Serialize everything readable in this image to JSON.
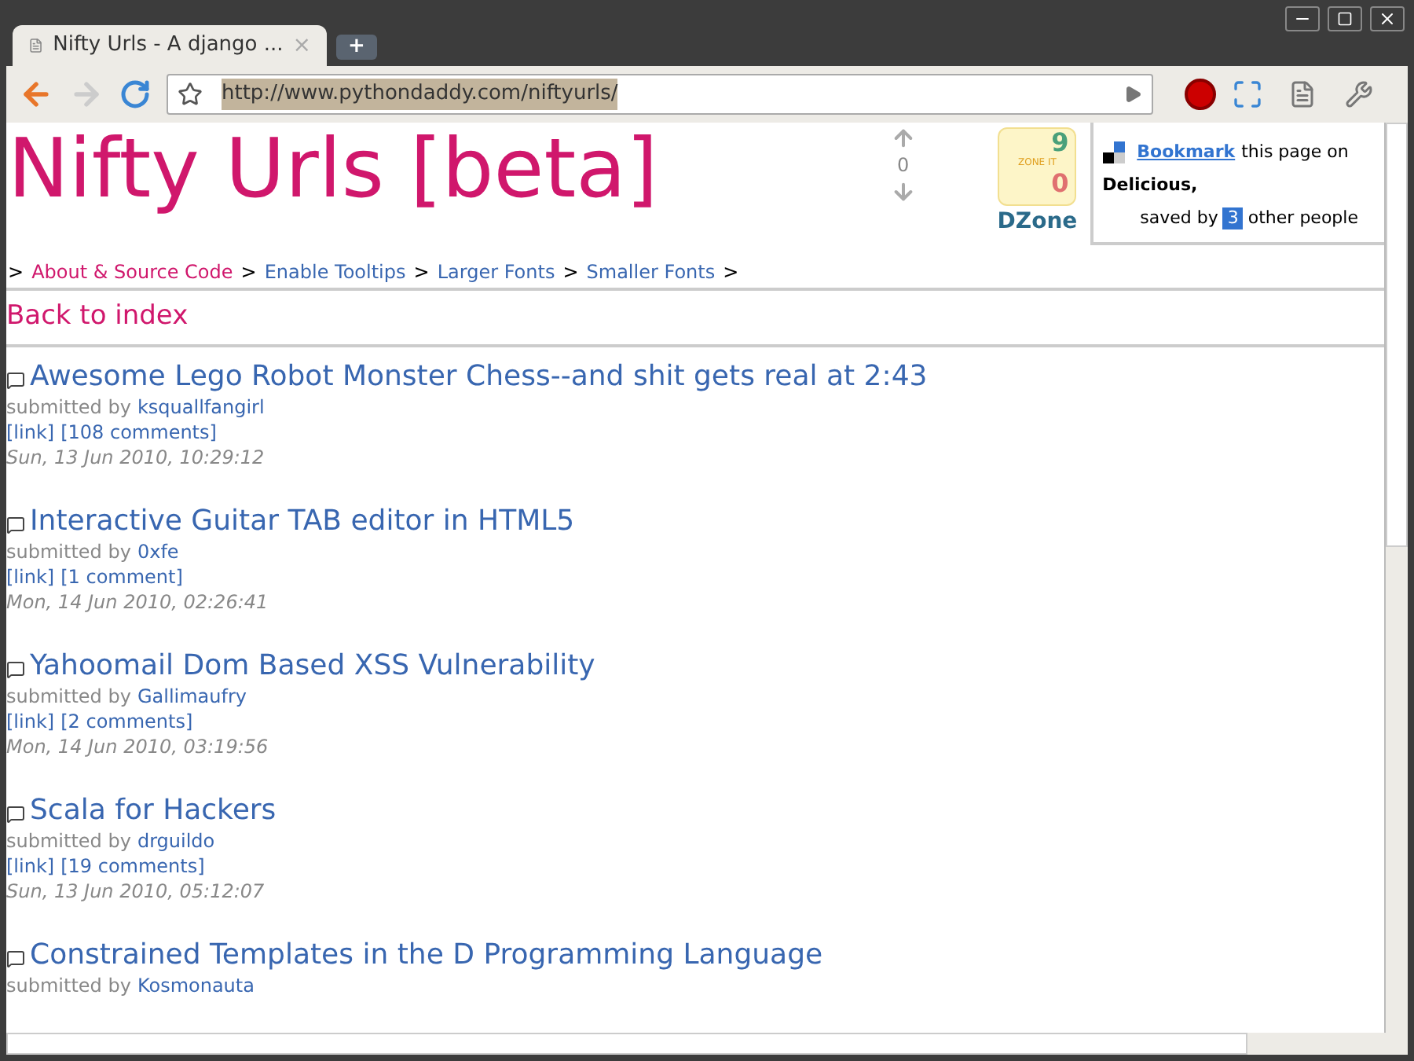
{
  "tab": {
    "title": "Nifty Urls - A django ...",
    "close": "×",
    "new_tab": "+"
  },
  "address_bar": {
    "url": "http://www.pythondaddy.com/niftyurls/"
  },
  "page": {
    "title": "Nifty Urls [beta]",
    "vote": {
      "count": "0"
    },
    "dzone": {
      "up": "9",
      "label": "ZONE IT",
      "down": "0",
      "brand": "DZone"
    },
    "delicious": {
      "link": "Bookmark",
      "text": "this page on",
      "site": "Delicious,",
      "saved_prefix": "saved by",
      "count": "3",
      "saved_suffix": "other people"
    },
    "nav": [
      {
        "label": "About & Source Code",
        "current": true
      },
      {
        "label": "Enable Tooltips",
        "current": false
      },
      {
        "label": "Larger Fonts",
        "current": false
      },
      {
        "label": "Smaller Fonts",
        "current": false
      }
    ],
    "nav_separator": ">",
    "back_link": "Back to index",
    "posts": [
      {
        "title": "Awesome Lego Robot Monster Chess--and shit gets real at 2:43",
        "submitted": "submitted by",
        "user": "ksquallfangirl",
        "link": "[link]",
        "comments": "[108 comments]",
        "date": "Sun, 13 Jun 2010, 10:29:12"
      },
      {
        "title": "Interactive Guitar TAB editor in HTML5",
        "submitted": "submitted by",
        "user": "0xfe",
        "link": "[link]",
        "comments": "[1 comment]",
        "date": "Mon, 14 Jun 2010, 02:26:41"
      },
      {
        "title": "Yahoomail Dom Based XSS Vulnerability",
        "submitted": "submitted by",
        "user": "Gallimaufry",
        "link": "[link]",
        "comments": "[2 comments]",
        "date": "Mon, 14 Jun 2010, 03:19:56"
      },
      {
        "title": "Scala for Hackers",
        "submitted": "submitted by",
        "user": "drguildo",
        "link": "[link]",
        "comments": "[19 comments]",
        "date": "Sun, 13 Jun 2010, 05:12:07"
      },
      {
        "title": "Constrained Templates in the D Programming Language",
        "submitted": "submitted by",
        "user": "Kosmonauta"
      }
    ]
  }
}
